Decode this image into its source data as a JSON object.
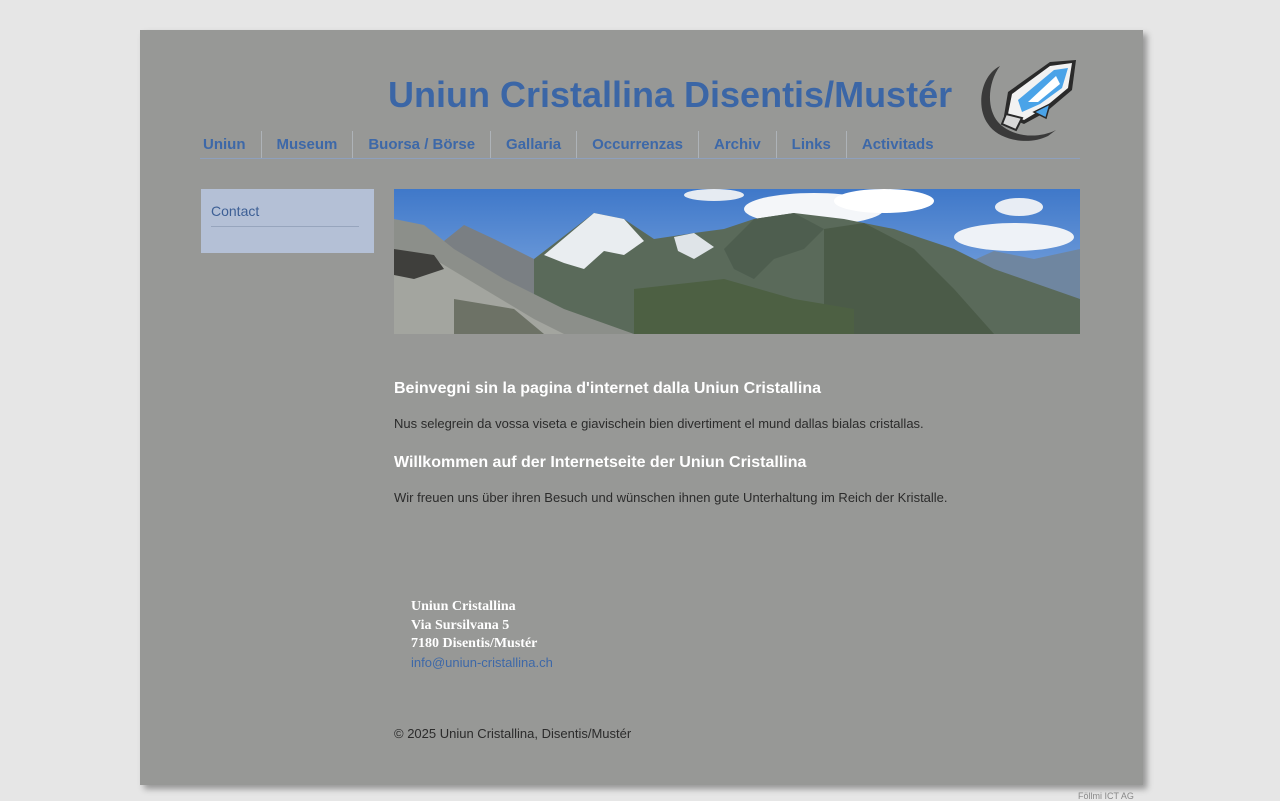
{
  "header": {
    "site_title": "Uniun Cristallina Disentis/Mustér",
    "logo_icon": "crystal-logo-icon"
  },
  "nav": {
    "items": [
      {
        "label": "Uniun"
      },
      {
        "label": "Museum"
      },
      {
        "label": "Buorsa / Börse"
      },
      {
        "label": "Gallaria"
      },
      {
        "label": "Occurrenzas"
      },
      {
        "label": "Archiv"
      },
      {
        "label": "Links"
      },
      {
        "label": "Activitads"
      }
    ]
  },
  "sidebar": {
    "items": [
      {
        "label": "Contact"
      }
    ]
  },
  "banner": {
    "icon": "mountain-panorama-image"
  },
  "content": {
    "heading_rm": "Beinvegni sin la pagina d'internet dalla Uniun Cristallina",
    "text_rm": "Nus selegrein da vossa viseta e giavischein bien divertiment el mund dallas bialas cristallas.",
    "heading_de": "Willkommen auf der Internetseite der Uniun Cristallina",
    "text_de": "Wir freuen uns über ihren Besuch und wünschen ihnen gute Unterhaltung im Reich der Kristalle."
  },
  "address": {
    "name": "Uniun Cristallina",
    "street": "Via Sursilvana 5",
    "city": "7180 Disentis/Mustér",
    "email": "info@uniun-cristallina.ch"
  },
  "footer": {
    "copyright": "© 2025 Uniun Cristallina, Disentis/Mustér",
    "credit": "Föllmi ICT AG"
  },
  "colors": {
    "page_bg": "#979896",
    "outer_bg": "#e6e6e6",
    "title": "#3b66a6",
    "nav_link": "#3d68a8",
    "sidebar_bg": "#b4c0d6",
    "heading": "#ffffff"
  }
}
